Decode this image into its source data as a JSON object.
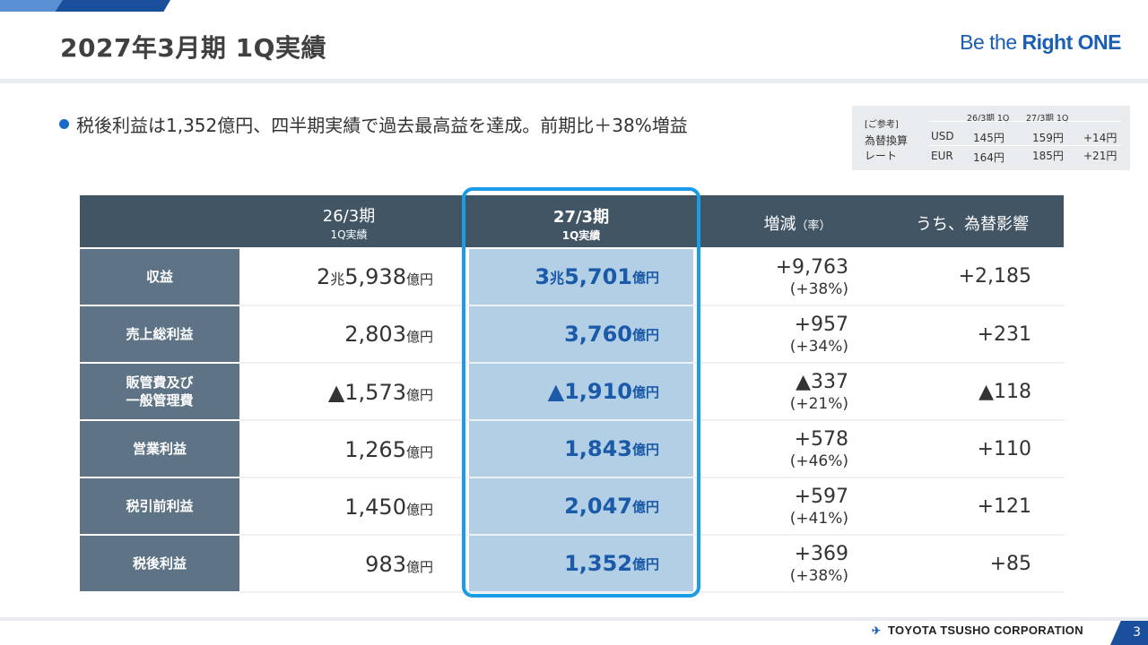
{
  "header": {
    "title": "2027年3月期 1Q実績",
    "brand_light": "Be the ",
    "brand_strong": "Right ONE"
  },
  "bullet": "税後利益は1,352億円、四半期実績で過去最高益を達成。前期比＋38%増益",
  "fx_reference": {
    "label_ref": "[ご参考]",
    "label_rate1": "為替換算",
    "label_rate2": "レート",
    "col_prev": "26/3期 1Q",
    "col_cur": "27/3期 1Q",
    "rows": [
      {
        "currency": "USD",
        "prev": "145円",
        "cur": "159円",
        "diff": "+14円"
      },
      {
        "currency": "EUR",
        "prev": "164円",
        "cur": "185円",
        "diff": "+21円"
      }
    ]
  },
  "table": {
    "headers": {
      "prev_l1": "26/3期",
      "prev_l2": "1Q実績",
      "cur_l1": "27/3期",
      "cur_l2": "1Q実績",
      "diff": "増減",
      "diff_sub": "（率）",
      "fx": "うち、為替影響"
    },
    "unit": "億円",
    "cho": "兆",
    "rows": [
      {
        "label": "収益",
        "prev_a": "2",
        "prev_b": "5,938",
        "cur_a": "3",
        "cur_b": "5,701",
        "diff": "+9,763",
        "pct": "(+38%)",
        "fx": "+2,185"
      },
      {
        "label": "売上総利益",
        "prev": "2,803",
        "cur": "3,760",
        "diff": "+957",
        "pct": "(+34%)",
        "fx": "+231"
      },
      {
        "label1": "販管費及び",
        "label2": "一般管理費",
        "prev": "▲1,573",
        "cur": "▲1,910",
        "diff": "▲337",
        "pct": "(+21%)",
        "fx": "▲118"
      },
      {
        "label": "営業利益",
        "prev": "1,265",
        "cur": "1,843",
        "diff": "+578",
        "pct": "(+46%)",
        "fx": "+110"
      },
      {
        "label": "税引前利益",
        "prev": "1,450",
        "cur": "2,047",
        "diff": "+597",
        "pct": "(+41%)",
        "fx": "+121"
      },
      {
        "label": "税後利益",
        "prev": "983",
        "cur": "1,352",
        "diff": "+369",
        "pct": "(+38%)",
        "fx": "+85"
      }
    ]
  },
  "footer": {
    "company": "TOYOTA TSUSHO CORPORATION",
    "page": "3"
  },
  "colors": {
    "accent": "#1a4f9c",
    "highlight_frame": "#1a9ce6",
    "highlight_fill": "#b3cfe6",
    "header_fill": "#425565",
    "label_fill": "#5e7385"
  }
}
